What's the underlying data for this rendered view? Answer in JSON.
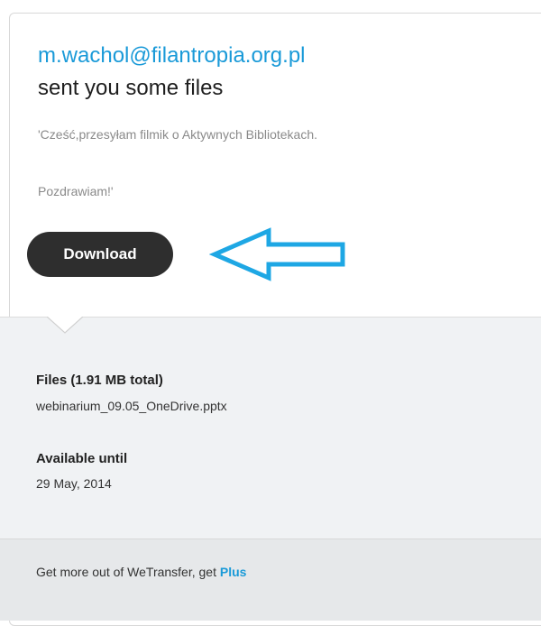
{
  "email": {
    "sender": "m.wachol@filantropia.org.pl",
    "headline": "sent you some files",
    "message_line1": "'Cześć,przesyłam filmik o Aktywnych Bibliotekach.",
    "message_line2": "Pozdrawiam!'",
    "download_label": "Download"
  },
  "details": {
    "files_label": "Files (1.91 MB total)",
    "file_name": "webinarium_09.05_OneDrive.pptx",
    "available_label": "Available until",
    "available_date": "29 May, 2014"
  },
  "footer": {
    "text": "Get more out of WeTransfer, get",
    "link": "Plus"
  },
  "colors": {
    "accent": "#1a9ad8",
    "button": "#2e2e2e",
    "arrow": "#1ea7e4"
  },
  "icons": {
    "annotation_arrow": "left-arrow-outline-icon"
  }
}
